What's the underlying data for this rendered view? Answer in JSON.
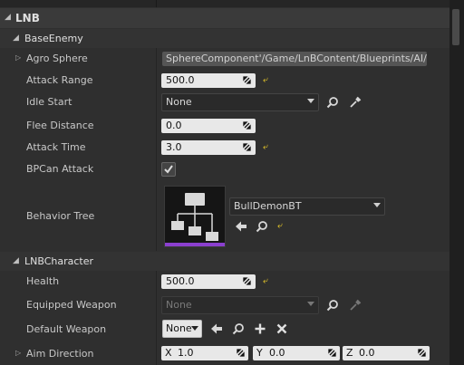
{
  "categories": {
    "lnb": "LNB",
    "base_enemy": "BaseEnemy",
    "lnb_character": "LNBCharacter"
  },
  "properties": {
    "agro_sphere": {
      "label": "Agro Sphere",
      "value": "SphereComponent'/Game/LnBContent/Blueprints/AI/Bul"
    },
    "attack_range": {
      "label": "Attack Range",
      "value": "500.0"
    },
    "idle_start": {
      "label": "Idle Start",
      "value": "None"
    },
    "flee_distance": {
      "label": "Flee Distance",
      "value": "0.0"
    },
    "attack_time": {
      "label": "Attack Time",
      "value": "3.0"
    },
    "bp_can_attack": {
      "label": "BPCan Attack",
      "checked": true
    },
    "behavior_tree": {
      "label": "Behavior Tree",
      "value": "BullDemonBT"
    },
    "health": {
      "label": "Health",
      "value": "500.0"
    },
    "equipped_weapon": {
      "label": "Equipped Weapon",
      "value": "None"
    },
    "default_weapon": {
      "label": "Default Weapon",
      "value": "None"
    },
    "aim_direction": {
      "label": "Aim Direction",
      "x_axis": "X",
      "x": "1.0",
      "y_axis": "Y",
      "y": "0.0",
      "z_axis": "Z",
      "z": "0.0"
    }
  },
  "colors": {
    "panel_bg": "#2f2f2f",
    "category_bg": "#3a3a3a",
    "field_bg": "#e8e8e8",
    "reset_arrow": "#f2d129",
    "thumbnail_accent": "#8b3fcf"
  },
  "icons": {
    "reset": "reset-arrow-icon",
    "browse": "magnifier-icon",
    "pick": "eyedropper-icon",
    "use": "left-arrow-icon",
    "add": "plus-icon",
    "clear": "x-icon"
  }
}
